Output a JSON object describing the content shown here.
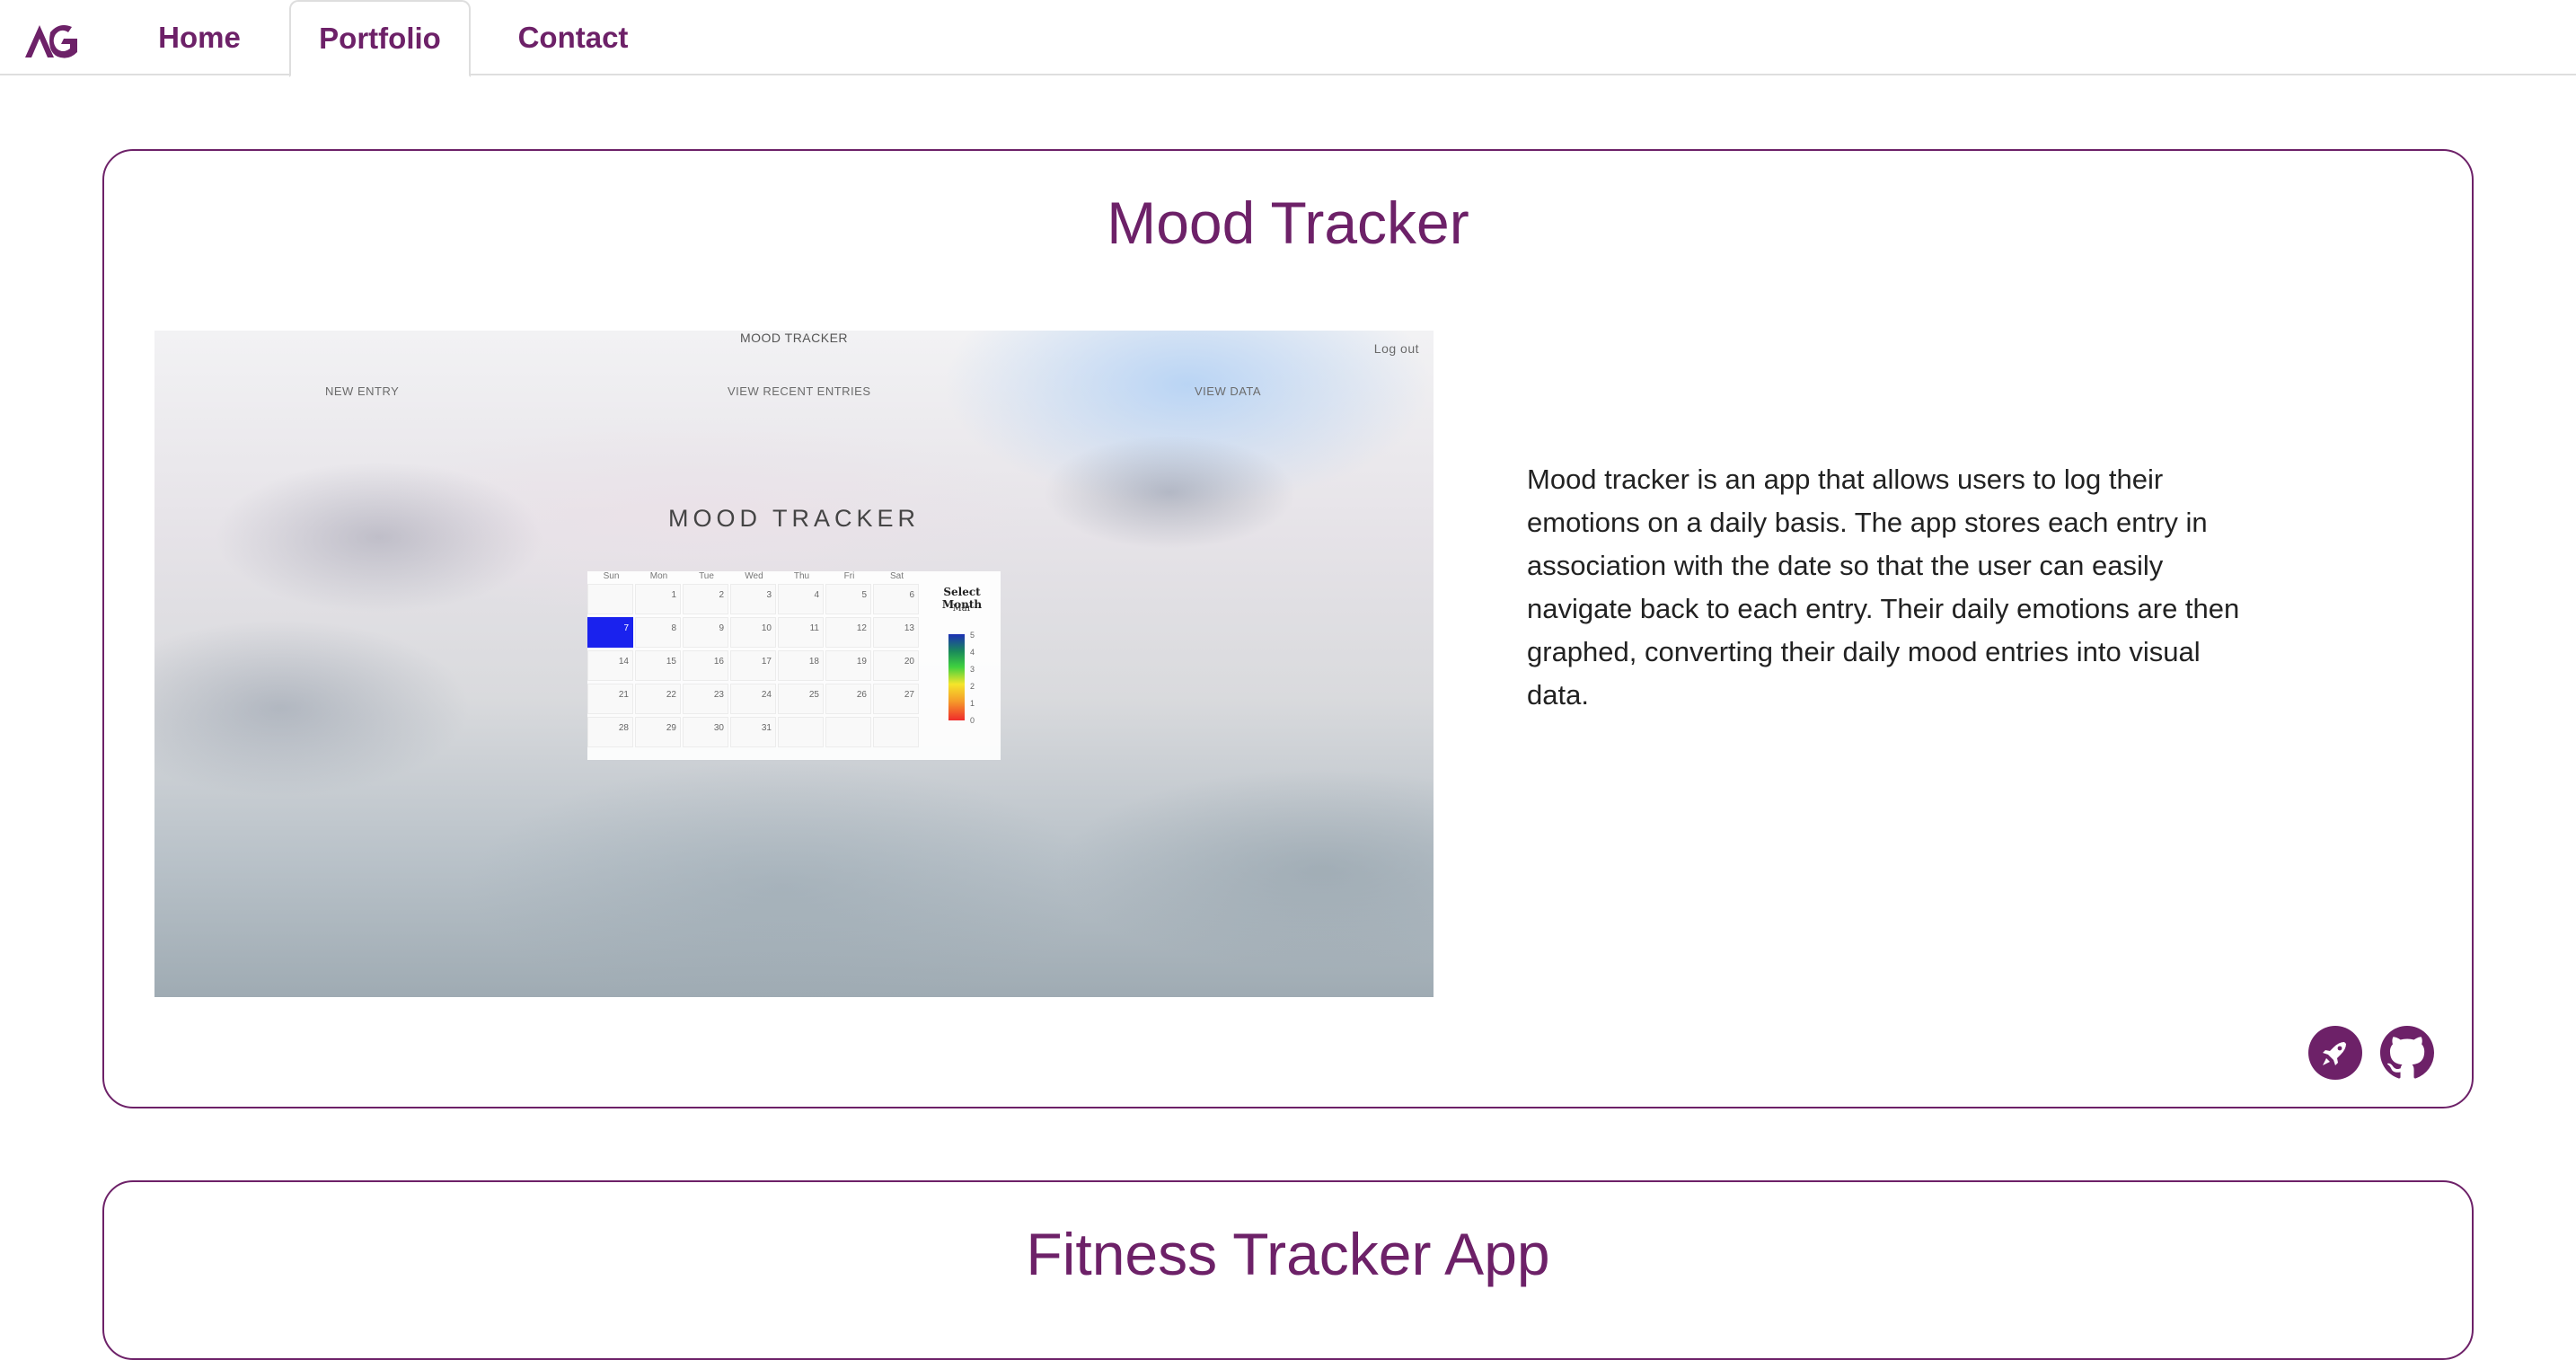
{
  "nav": {
    "items": [
      {
        "label": "Home"
      },
      {
        "label": "Portfolio"
      },
      {
        "label": "Contact"
      }
    ],
    "active": "Portfolio",
    "logo_icon": "ag-logo-icon"
  },
  "projects": [
    {
      "title": "Mood Tracker",
      "description": "Mood tracker is an app that allows users to log their emotions on a daily basis. The app stores each entry in association with the date so that the user can easily navigate back to each entry. Their daily emotions are then graphed, converting their daily mood entries into visual data.",
      "screenshot": {
        "top_title": "MOOD TRACKER",
        "logout": "Log out",
        "nav_new": "NEW ENTRY",
        "nav_recent": "VIEW RECENT ENTRIES",
        "nav_data": "VIEW DATA",
        "big_title": "MOOD TRACKER",
        "weekdays": [
          "Sun",
          "Mon",
          "Tue",
          "Wed",
          "Thu",
          "Fri",
          "Sat"
        ],
        "days": [
          "",
          "1",
          "2",
          "3",
          "4",
          "5",
          "6",
          "7",
          "8",
          "9",
          "10",
          "11",
          "12",
          "13",
          "14",
          "15",
          "16",
          "17",
          "18",
          "19",
          "20",
          "21",
          "22",
          "23",
          "24",
          "25",
          "26",
          "27",
          "28",
          "29",
          "30",
          "31"
        ],
        "selected_day": "7",
        "legend_title": "Select Month",
        "legend_month": "Mar",
        "legend_ticks": [
          "5",
          "4",
          "3",
          "2",
          "1",
          "0"
        ]
      },
      "links": [
        {
          "icon": "rocket-icon",
          "label": "Deployed app"
        },
        {
          "icon": "github-icon",
          "label": "GitHub repository"
        }
      ]
    },
    {
      "title": "Fitness Tracker App"
    }
  ],
  "colors": {
    "brand": "#6d2168",
    "nav_border": "#dedede",
    "selected_day": "#1a22ee"
  }
}
